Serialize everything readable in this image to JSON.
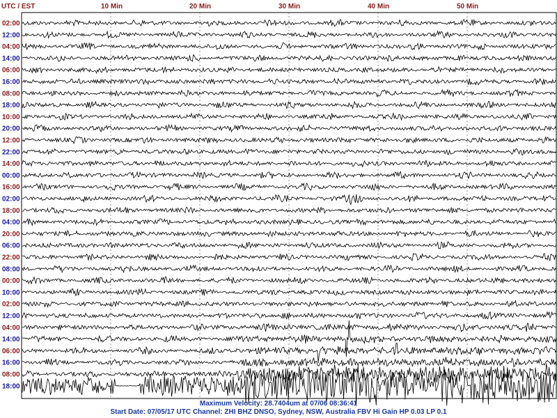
{
  "header": {
    "timezone_label": "UTC / EST",
    "minute_labels": [
      "10 Min",
      "20 Min",
      "30 Min",
      "40 Min",
      "50 Min"
    ]
  },
  "chart_data": {
    "type": "line",
    "x_unit": "Min",
    "x_range": [
      0,
      60
    ],
    "x_ticks": [
      10,
      20,
      30,
      40,
      50
    ],
    "rows": [
      {
        "utc": "02:00",
        "est": "12:00"
      },
      {
        "utc": "04:00",
        "est": "14:00"
      },
      {
        "utc": "06:00",
        "est": "16:00"
      },
      {
        "utc": "08:00",
        "est": "18:00"
      },
      {
        "utc": "10:00",
        "est": "20:00"
      },
      {
        "utc": "12:00",
        "est": "22:00"
      },
      {
        "utc": "14:00",
        "est": "00:00"
      },
      {
        "utc": "16:00",
        "est": "02:00"
      },
      {
        "utc": "18:00",
        "est": "04:00"
      },
      {
        "utc": "20:00",
        "est": "06:00"
      },
      {
        "utc": "22:00",
        "est": "08:00"
      },
      {
        "utc": "00:00",
        "est": "10:00"
      },
      {
        "utc": "02:00",
        "est": "12:00"
      },
      {
        "utc": "04:00",
        "est": "14:00"
      },
      {
        "utc": "06:00",
        "est": "16:00"
      },
      {
        "utc": "08:00",
        "est": "18:00"
      }
    ],
    "grid": true
  },
  "footer": {
    "max_velocity": "Maximum Velocity: 28.7404um at 07/06 08:36:41",
    "station_info": "Start Date: 07/05/17 UTC Channel: ZHI  BHZ  DNSO, Sydney, NSW, Australia  FBV Hi Gain HP 0.03  LP 0.1"
  },
  "colors": {
    "utc_label": "#8b1a1a",
    "est_label": "#1a1aa0",
    "trace": "#000000",
    "footer_text": "#1a3aa0"
  }
}
